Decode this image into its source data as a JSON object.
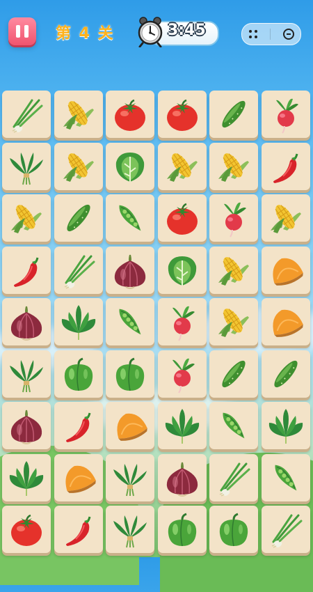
{
  "header": {
    "pause_icon": "pause-icon",
    "level_text": "第 4 关",
    "timer_text": "3:45",
    "clock_icon": "alarm-clock-icon",
    "menu_icon": "more-dots-icon",
    "close_icon": "minimize-circle-icon"
  },
  "board": {
    "columns": 6,
    "rows": 9,
    "tiles": [
      [
        "scallion",
        "corn",
        "tomato",
        "tomato",
        "cucumber",
        "radish"
      ],
      [
        "leafy-bunch",
        "corn",
        "bok-choy",
        "corn",
        "corn",
        "chili-pepper"
      ],
      [
        "corn",
        "cucumber",
        "pea-pod",
        "tomato",
        "radish",
        "corn"
      ],
      [
        "chili-pepper",
        "scallion",
        "red-onion",
        "bok-choy",
        "corn",
        "pumpkin-slice"
      ],
      [
        "red-onion",
        "spinach",
        "pea-pod",
        "radish",
        "corn",
        "pumpkin-slice"
      ],
      [
        "leafy-bunch",
        "bell-pepper",
        "bell-pepper",
        "radish",
        "cucumber",
        "cucumber"
      ],
      [
        "red-onion",
        "chili-pepper",
        "pumpkin-slice",
        "spinach",
        "pea-pod",
        "spinach"
      ],
      [
        "spinach",
        "pumpkin-slice",
        "leafy-bunch",
        "red-onion",
        "scallion",
        "pea-pod"
      ],
      [
        "tomato",
        "chili-pepper",
        "leafy-bunch",
        "bell-pepper",
        "bell-pepper",
        "scallion"
      ]
    ]
  },
  "colors": {
    "tile_face": "#f3e3c8",
    "level_text": "#ffb21c",
    "pause_button": "#f0546f"
  }
}
